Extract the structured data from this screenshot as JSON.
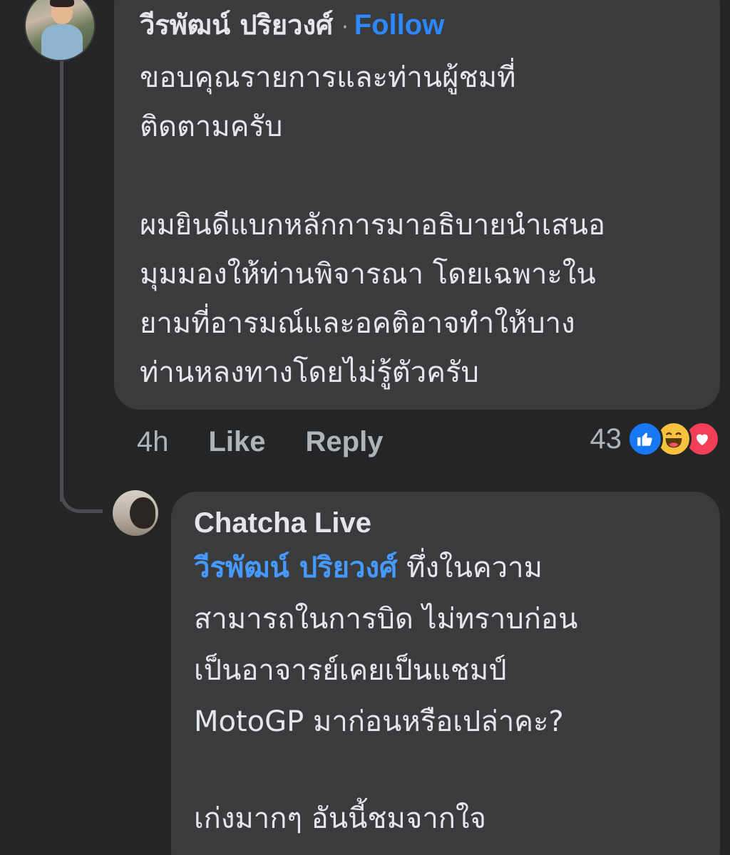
{
  "main_comment": {
    "author": "วีรพัฒน์ ปริยวงศ์",
    "separator": "·",
    "follow_label": "Follow",
    "paragraphs": [
      [
        "ขอบคุณรายการและท่านผู้ชมที่",
        "ติดตามครับ"
      ],
      [
        "ผมยินดีแบกหลักการมาอธิบายนำเสนอ",
        "มุมมองให้ท่านพิจารณา โดยเฉพาะใน",
        "ยามที่อารมณ์และอคติอาจทำให้บาง",
        "ท่านหลงทางโดยไม่รู้ตัวครับ"
      ]
    ],
    "time": "4h",
    "like_label": "Like",
    "reply_label": "Reply",
    "reaction_count": "43",
    "reactions": [
      "like-icon",
      "haha-icon",
      "love-icon"
    ],
    "colors": {
      "bubble": "#3a3b3c",
      "background": "#242526",
      "follow": "#2d88ff",
      "like_reaction": "#1877f2",
      "haha_reaction": "#f7c33f",
      "love_reaction": "#f33e58"
    }
  },
  "reply_comment": {
    "author": "Chatcha Live",
    "mention": "วีรพัฒน์ ปริยวงศ์",
    "first_line_rest": " ทึ่งในความ",
    "lines_after": [
      "สามารถในการบิด ไม่ทราบก่อน",
      "เป็นอาจารย์เคยเป็นแชมป์",
      "MotoGP มาก่อนหรือเปล่าคะ?"
    ],
    "last_paragraph": "เก่งมากๆ อันนี้ชมจากใจ",
    "mention_color": "#4599ff"
  }
}
